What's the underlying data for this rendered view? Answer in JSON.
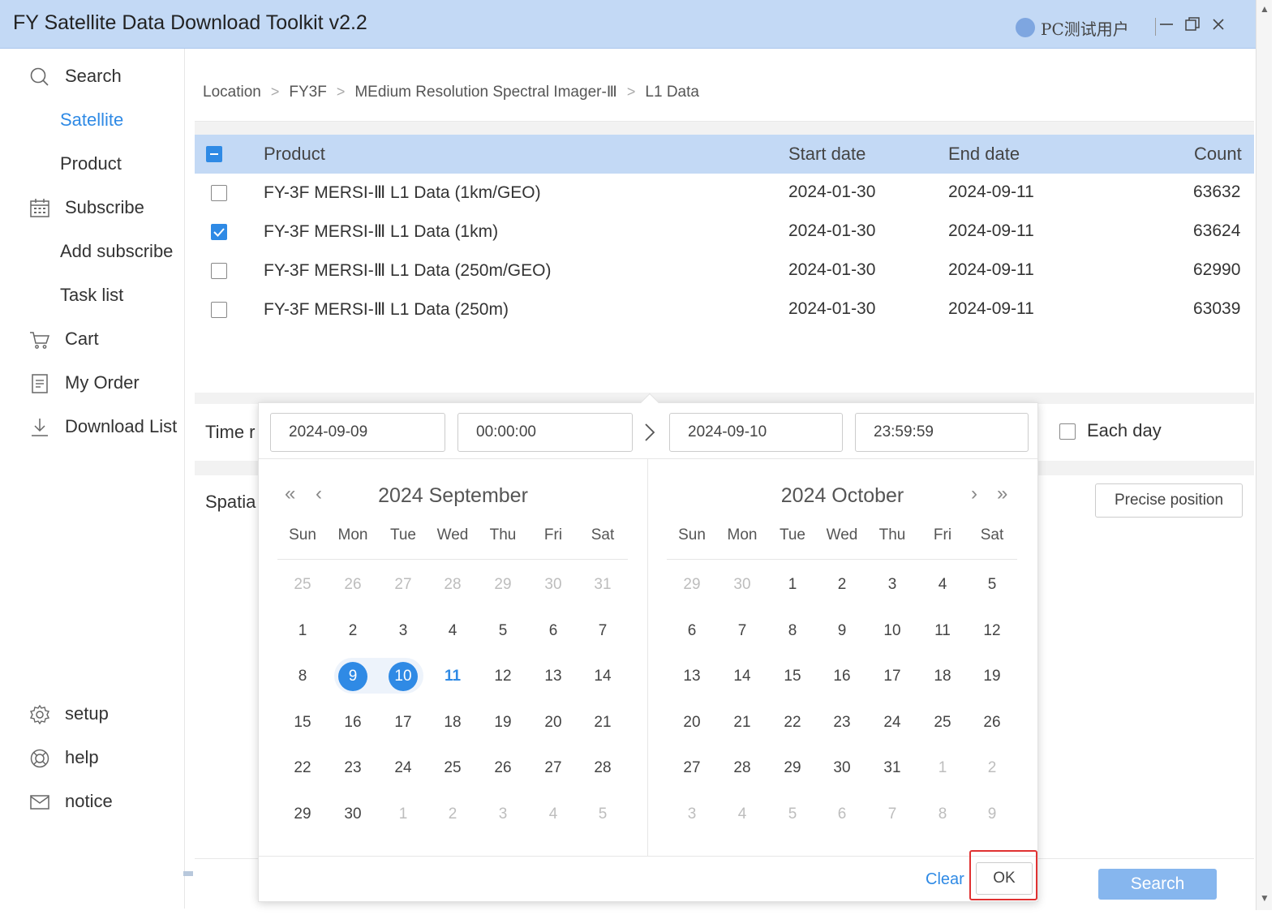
{
  "app": {
    "title": "FY Satellite Data Download Toolkit v2.2",
    "user": "PC测试用户"
  },
  "sidebar": {
    "search": "Search",
    "satellite": "Satellite",
    "product": "Product",
    "subscribe": "Subscribe",
    "add_subscribe": "Add subscribe",
    "task_list": "Task list",
    "cart": "Cart",
    "my_order": "My Order",
    "download_list": "Download List",
    "setup": "setup",
    "help": "help",
    "notice": "notice"
  },
  "breadcrumb": [
    "Location",
    "FY3F",
    "MEdium Resolution Spectral Imager-Ⅲ",
    "L1 Data"
  ],
  "table": {
    "headers": {
      "product": "Product",
      "start": "Start date",
      "end": "End date",
      "count": "Count"
    },
    "rows": [
      {
        "product": "FY-3F MERSI-Ⅲ L1 Data (1km/GEO)",
        "start": "2024-01-30",
        "end": "2024-09-11",
        "count": "63632",
        "checked": false
      },
      {
        "product": "FY-3F MERSI-Ⅲ L1 Data (1km)",
        "start": "2024-01-30",
        "end": "2024-09-11",
        "count": "63624",
        "checked": true
      },
      {
        "product": "FY-3F MERSI-Ⅲ L1 Data (250m/GEO)",
        "start": "2024-01-30",
        "end": "2024-09-11",
        "count": "62990",
        "checked": false
      },
      {
        "product": "FY-3F MERSI-Ⅲ L1 Data (250m)",
        "start": "2024-01-30",
        "end": "2024-09-11",
        "count": "63039",
        "checked": false
      }
    ]
  },
  "time": {
    "label": "Time r",
    "each_day": "Each day"
  },
  "spatial": {
    "label": "Spatia",
    "precise_button": "Precise position"
  },
  "search_button": "Search",
  "picker": {
    "start_date": "2024-09-09",
    "start_time": "00:00:00",
    "end_date": "2024-09-10",
    "end_time": "23:59:59",
    "left_title": "2024 September",
    "right_title": "2024 October",
    "weekdays": [
      "Sun",
      "Mon",
      "Tue",
      "Wed",
      "Thu",
      "Fri",
      "Sat"
    ],
    "left_days": [
      "25",
      "26",
      "27",
      "28",
      "29",
      "30",
      "31",
      "1",
      "2",
      "3",
      "4",
      "5",
      "6",
      "7",
      "8",
      "9",
      "10",
      "11",
      "12",
      "13",
      "14",
      "15",
      "16",
      "17",
      "18",
      "19",
      "20",
      "21",
      "22",
      "23",
      "24",
      "25",
      "26",
      "27",
      "28",
      "29",
      "30",
      "1",
      "2",
      "3",
      "4",
      "5"
    ],
    "right_days": [
      "29",
      "30",
      "1",
      "2",
      "3",
      "4",
      "5",
      "6",
      "7",
      "8",
      "9",
      "10",
      "11",
      "12",
      "13",
      "14",
      "15",
      "16",
      "17",
      "18",
      "19",
      "20",
      "21",
      "22",
      "23",
      "24",
      "25",
      "26",
      "27",
      "28",
      "29",
      "30",
      "31",
      "1",
      "2",
      "3",
      "4",
      "5",
      "6",
      "7",
      "8",
      "9"
    ],
    "clear": "Clear",
    "ok": "OK"
  },
  "colors": {
    "accent": "#2f8ae5",
    "titlebar": "#c3d9f5",
    "highlight": "#e03131"
  }
}
